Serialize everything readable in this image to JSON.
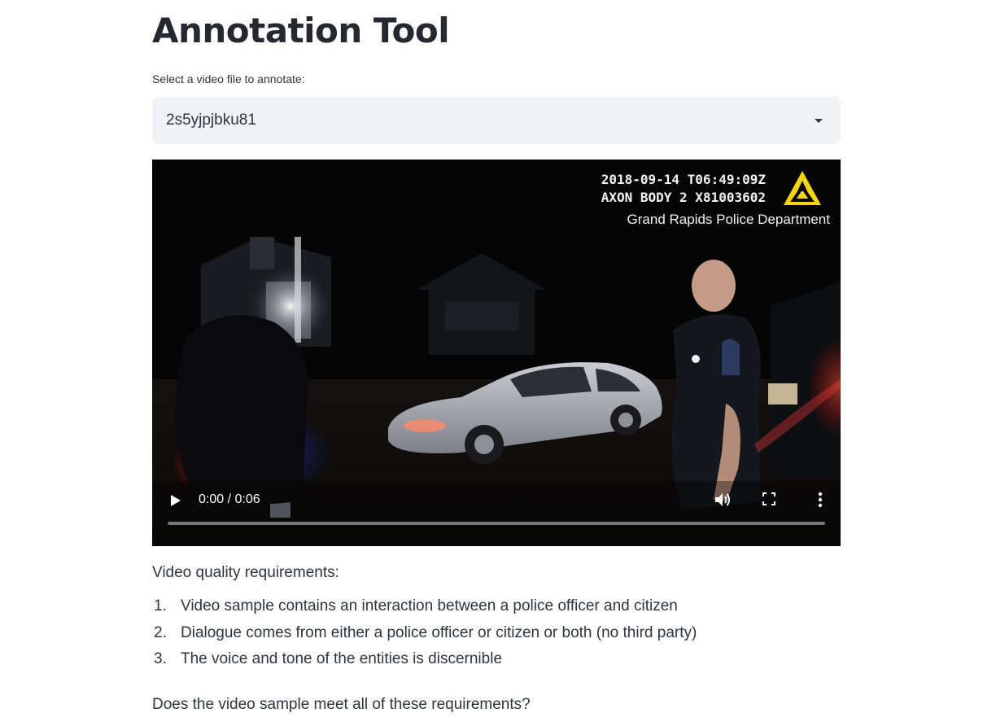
{
  "page": {
    "title": "Annotation Tool"
  },
  "file_select": {
    "label": "Select a video file to annotate:",
    "value": "2s5yjpjbku81",
    "caret_icon": "chevron-down-icon"
  },
  "video": {
    "overlay": {
      "timestamp": "2018-09-14 T06:49:09Z",
      "device": "AXON BODY 2 X81003602",
      "department": "Grand Rapids Police Department",
      "logo_icon": "axon-triangle-logo"
    },
    "controls": {
      "time": "0:00 / 0:06",
      "progress": 0,
      "play_icon": "play-icon",
      "volume_icon": "volume-icon",
      "fullscreen_icon": "fullscreen-icon",
      "more_icon": "more-vertical-icon"
    }
  },
  "requirements": {
    "title": "Video quality requirements:",
    "items": [
      {
        "num": "1.",
        "text": "Video sample contains an interaction between a police officer and citizen"
      },
      {
        "num": "2.",
        "text": "Dialogue comes from either a police officer or citizen or both (no third party)"
      },
      {
        "num": "3.",
        "text": "The voice and tone of the entities is discernible"
      }
    ]
  },
  "question": "Does the video sample meet all of these requirements?",
  "colors": {
    "select_bg": "#f0f2f6",
    "text": "#31333f",
    "heading": "#262730",
    "video_bg": "#050506",
    "logo_yellow": "#f5d316"
  }
}
